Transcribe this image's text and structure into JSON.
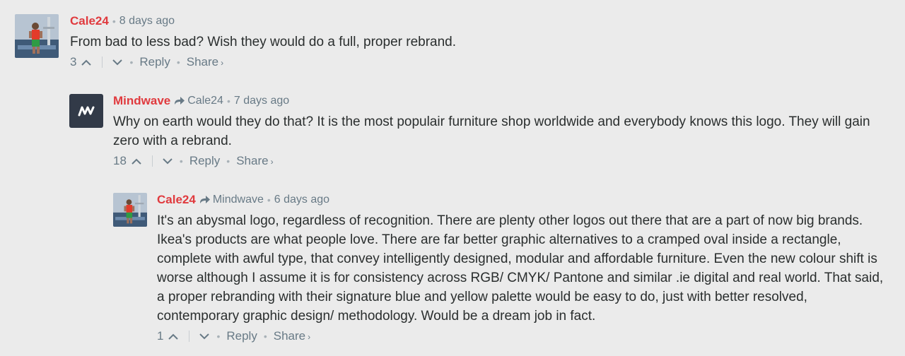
{
  "comments": [
    {
      "author": "Cale24",
      "time": "8 days ago",
      "text": "From bad to less bad? Wish they would do a full, proper rebrand.",
      "votes": "3",
      "reply_label": "Reply",
      "share_label": "Share",
      "share_chevron": "›",
      "avatar": "surfer-photo"
    },
    {
      "author": "Mindwave",
      "reply_to": "Cale24",
      "time": "7 days ago",
      "text": "Why on earth would they do that? It is the most populair furniture shop worldwide and everybody knows this logo. They will gain zero with a rebrand.",
      "votes": "18",
      "reply_label": "Reply",
      "share_label": "Share",
      "share_chevron": "›",
      "avatar": "mindwave-logo"
    },
    {
      "author": "Cale24",
      "reply_to": "Mindwave",
      "time": "6 days ago",
      "text": "It's an abysmal logo, regardless of recognition. There are plenty other logos out there that are a part of now big brands. Ikea's products are what people love. There are far better graphic alternatives to a cramped oval inside a rectangle, complete with awful type, that convey intelligently designed, modular and affordable furniture. Even the new colour shift is worse although I assume it is for consistency across RGB/ CMYK/ Pantone and similar .ie digital and real world. That said, a proper rebranding with their signature blue and yellow palette would be easy to do, just with better resolved, contemporary graphic design/ methodology. Would be a dream job in fact.",
      "votes": "1",
      "reply_label": "Reply",
      "share_label": "Share",
      "share_chevron": "›",
      "avatar": "surfer-photo"
    }
  ],
  "colors": {
    "background": "#ebebeb",
    "author": "#e03a3e",
    "meta": "#687a86",
    "text": "#2a2e2e",
    "avatar_dark": "#323a48"
  },
  "icons": {
    "reply_to": "reply-arrow-icon",
    "upvote": "chevron-up-icon",
    "downvote": "chevron-down-icon"
  }
}
